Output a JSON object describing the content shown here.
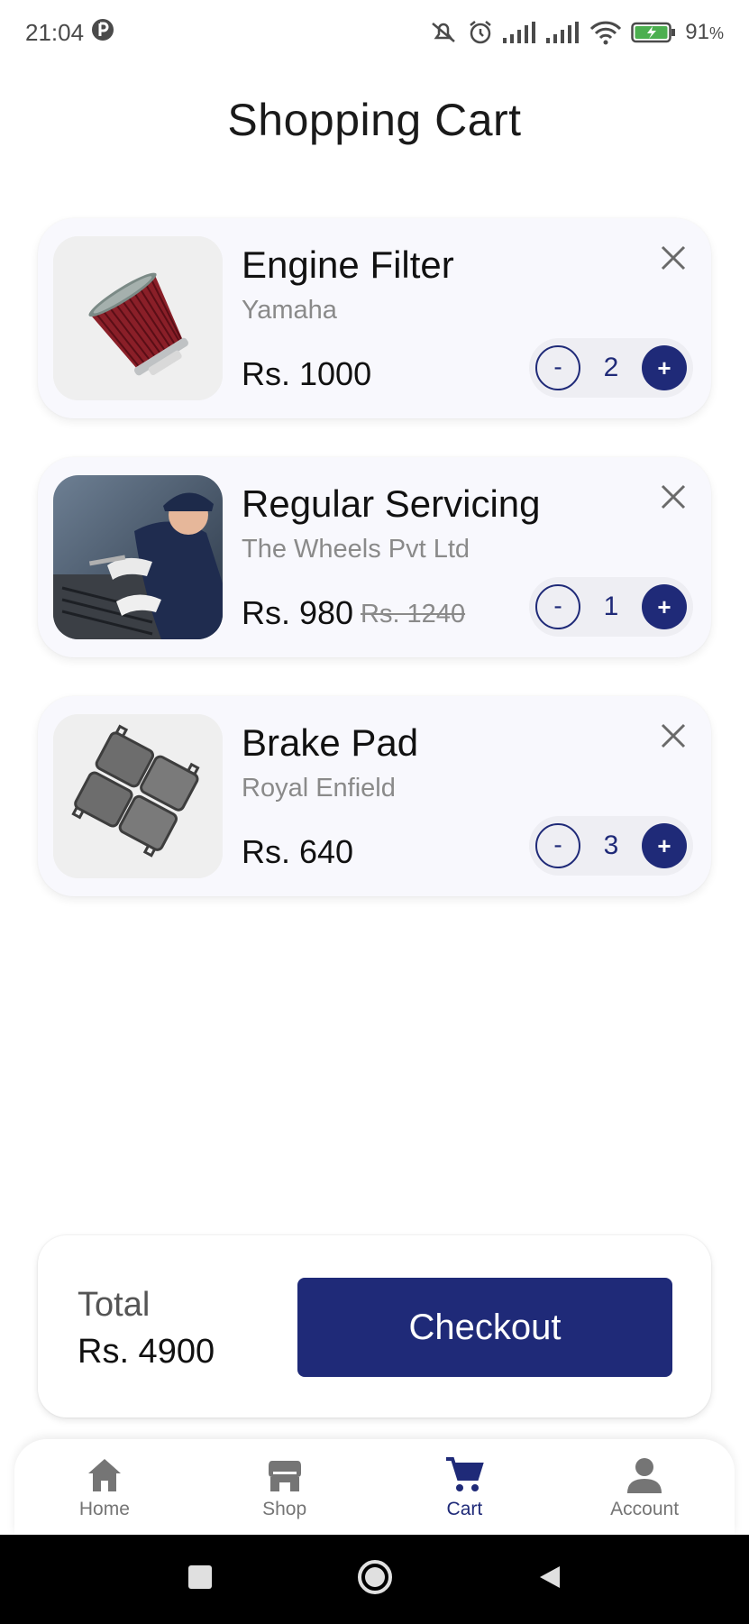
{
  "status_bar": {
    "time": "21:04",
    "battery_percent": "91",
    "battery_unit": "%"
  },
  "page": {
    "title": "Shopping Cart"
  },
  "cart": {
    "items": [
      {
        "name": "Engine Filter",
        "vendor": "Yamaha",
        "price": "Rs. 1000",
        "old_price": "",
        "quantity": "2",
        "minus": "-",
        "plus": "+"
      },
      {
        "name": "Regular Servicing",
        "vendor": "The Wheels Pvt Ltd",
        "price": "Rs. 980",
        "old_price": "Rs. 1240",
        "quantity": "1",
        "minus": "-",
        "plus": "+"
      },
      {
        "name": "Brake Pad",
        "vendor": "Royal Enfield",
        "price": "Rs. 640",
        "old_price": "",
        "quantity": "3",
        "minus": "-",
        "plus": "+"
      }
    ]
  },
  "summary": {
    "total_label": "Total",
    "total_value": "Rs. 4900",
    "checkout_label": "Checkout"
  },
  "bottom_nav": {
    "items": [
      {
        "label": "Home",
        "icon": "home-icon",
        "active": false
      },
      {
        "label": "Shop",
        "icon": "shop-icon",
        "active": false
      },
      {
        "label": "Cart",
        "icon": "cart-icon",
        "active": true
      },
      {
        "label": "Account",
        "icon": "account-icon",
        "active": false
      }
    ]
  },
  "colors": {
    "primary": "#1f2a78",
    "card_background": "#f8f8fd",
    "muted_text": "#8a8a8a"
  }
}
